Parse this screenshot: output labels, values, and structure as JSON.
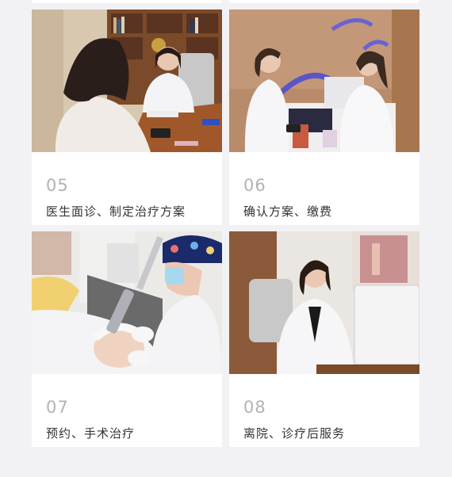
{
  "steps": [
    {
      "num": "05",
      "label": "医生面诊、制定治疗方案",
      "photo": "doctor-consultation-photo"
    },
    {
      "num": "06",
      "label": "确认方案、缴费",
      "photo": "front-desk-payment-photo"
    },
    {
      "num": "07",
      "label": "预约、手术治疗",
      "photo": "laser-treatment-photo"
    },
    {
      "num": "08",
      "label": "离院、诊疗后服务",
      "photo": "aftercare-service-photo"
    }
  ],
  "colors": {
    "page_bg": "#f2f2f4",
    "card_bg": "#ffffff",
    "number": "#b3b3b3",
    "caption": "#333333"
  }
}
